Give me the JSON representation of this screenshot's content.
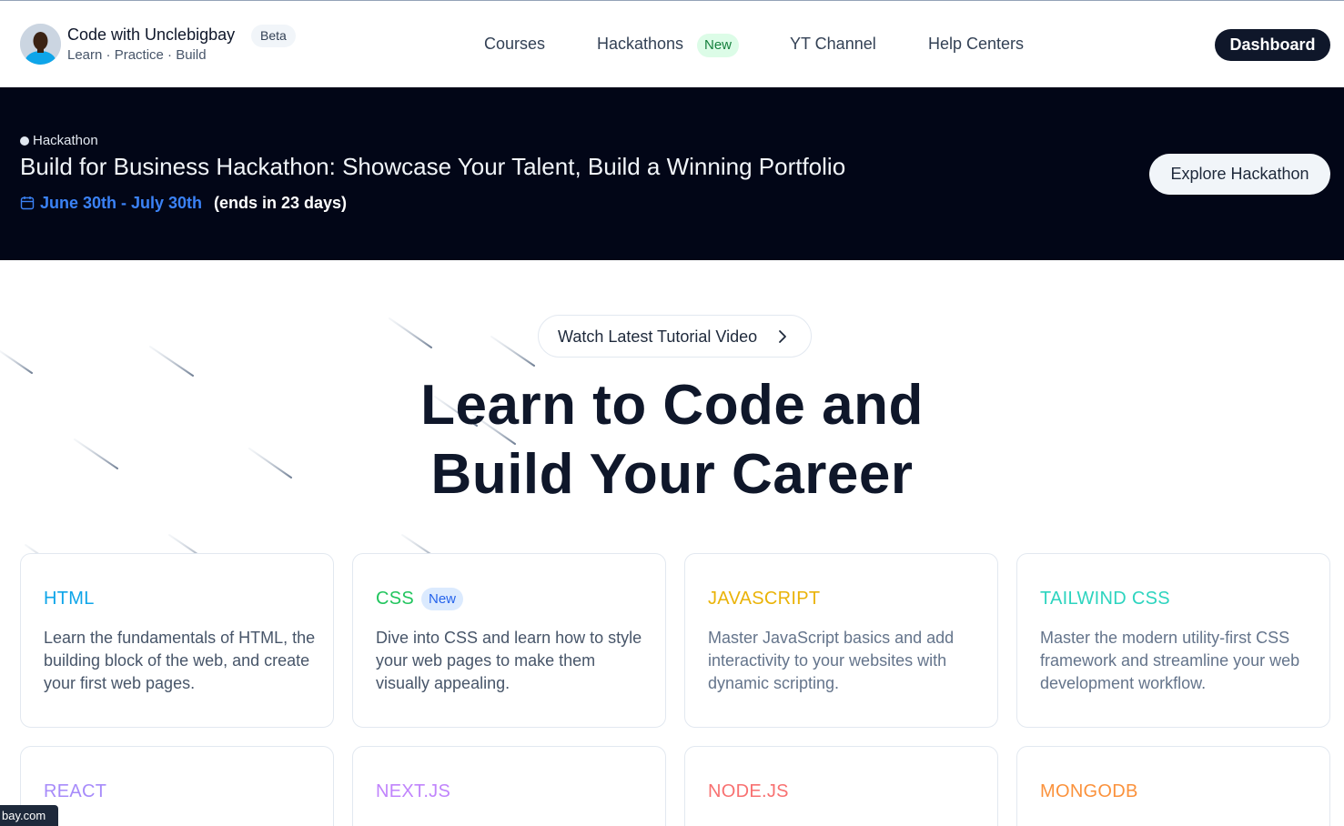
{
  "header": {
    "brand_name": "Code with Unclebigbay",
    "brand_badge": "Beta",
    "brand_sub": "Learn · Practice · Build",
    "nav": {
      "courses": "Courses",
      "hackathons": "Hackathons",
      "hackathons_badge": "New",
      "yt_channel": "YT Channel",
      "help_centers": "Help Centers"
    },
    "dashboard_label": "Dashboard"
  },
  "banner": {
    "tag": "Hackathon",
    "title": "Build for Business Hackathon: Showcase Your Talent, Build a Winning Portfolio",
    "dates": "June 30th - July 30th",
    "ends": "(ends in 23 days)",
    "cta": "Explore Hackathon"
  },
  "hero": {
    "watch_label": "Watch Latest Tutorial Video",
    "title_line1": "Learn to Code and",
    "title_line2": "Build Your Career"
  },
  "courses": [
    {
      "title": "HTML",
      "badge": "",
      "desc": "Learn the fundamentals of HTML, the building block of the web, and create your first web pages.",
      "color": "#0ea5e9"
    },
    {
      "title": "CSS",
      "badge": "New",
      "desc": "Dive into CSS and learn how to style your web pages to make them visually appealing.",
      "color": "#22c55e"
    },
    {
      "title": "JAVASCRIPT",
      "badge": "",
      "desc": "Master JavaScript basics and add interactivity to your websites with dynamic scripting.",
      "color": "#eab308"
    },
    {
      "title": "TAILWIND CSS",
      "badge": "",
      "desc": "Master the modern utility-first CSS framework and streamline your web development workflow.",
      "color": "#2dd4bf"
    },
    {
      "title": "REACT",
      "badge": "",
      "desc": "",
      "color": "#a78bfa"
    },
    {
      "title": "NEXT.JS",
      "badge": "",
      "desc": "",
      "color": "#c084fc"
    },
    {
      "title": "NODE.JS",
      "badge": "",
      "desc": "",
      "color": "#f87171"
    },
    {
      "title": "MONGODB",
      "badge": "",
      "desc": "",
      "color": "#fb923c"
    }
  ],
  "status_url": "bay.com",
  "icons": {
    "avatar": "avatar-photo",
    "calendar": "calendar-icon",
    "chevron": "chevron-right-icon"
  }
}
